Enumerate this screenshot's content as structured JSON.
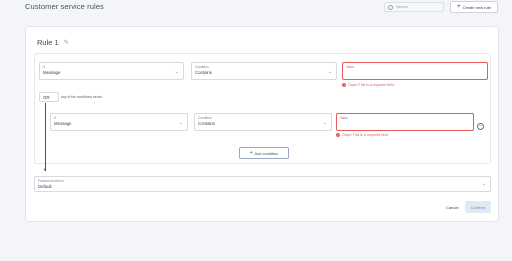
{
  "header": {
    "title": "Customer service rules",
    "search_placeholder": "Search",
    "create_button": "Create new rule"
  },
  "rule": {
    "title": "Rule 1",
    "primary_condition": {
      "if_label": "If",
      "if_value": "Message",
      "condition_label": "Condition",
      "condition_value": "Contains",
      "value_label": "Value",
      "error": "Oops! This is a required field."
    },
    "group": {
      "operator": "OR",
      "description": "any of the conditions below"
    },
    "nested_condition": {
      "if_label": "If",
      "if_value": "Message",
      "condition_label": "Condition",
      "condition_value": "Contains",
      "value_label": "Value",
      "error": "Oops! This is a required field."
    },
    "add_condition_label": "Add condition"
  },
  "forward": {
    "label": "Forward service to",
    "value": "Default"
  },
  "actions": {
    "cancel": "Cancel",
    "confirm": "Confirm"
  },
  "colors": {
    "error": "#e35c5c",
    "confirm_bg": "#e2e8f5",
    "page_bg": "#f4f5f8"
  }
}
